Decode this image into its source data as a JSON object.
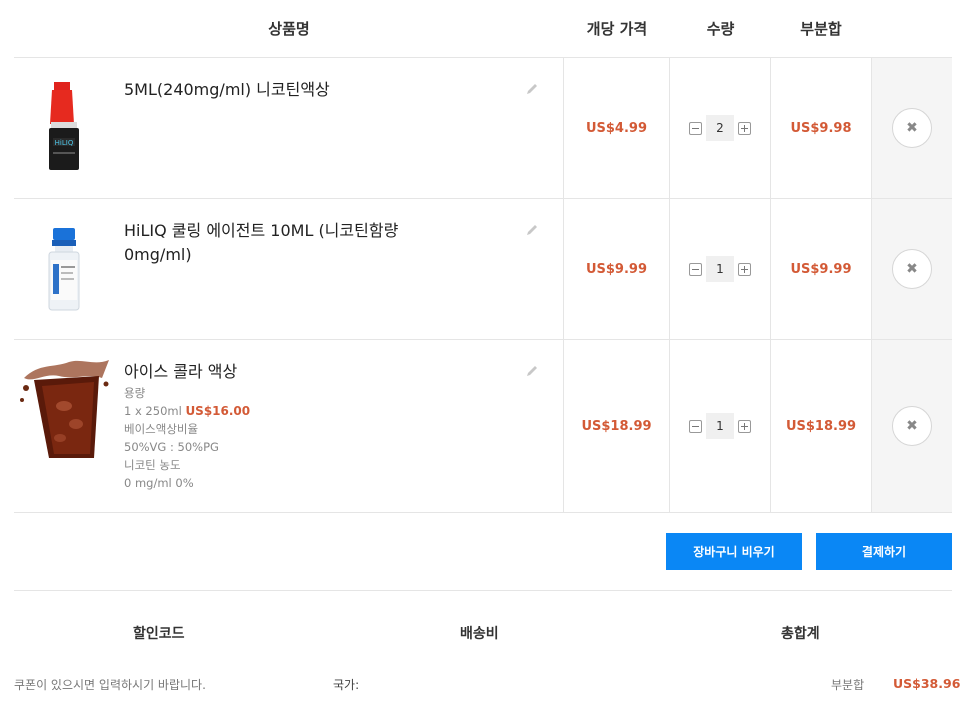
{
  "table": {
    "headers": {
      "product": "상품명",
      "price": "개당 가격",
      "qty": "수량",
      "subtotal": "부분합"
    }
  },
  "items": [
    {
      "name": "5ML(240mg/ml) 니코틴액상",
      "price": "US$4.99",
      "qty": "2",
      "subtotal": "US$9.98",
      "image": "red-cap-bottle"
    },
    {
      "name": "HiLIQ 쿨링 에이전트 10ML (니코틴함량 0mg/ml)",
      "price": "US$9.99",
      "qty": "1",
      "subtotal": "US$9.99",
      "image": "blue-cap-bottle"
    },
    {
      "name": "아이스 콜라 액상",
      "price": "US$18.99",
      "qty": "1",
      "subtotal": "US$18.99",
      "image": "cola-glass",
      "meta": {
        "capacity_label": "용량",
        "capacity_value": "1 x 250ml",
        "capacity_price": "US$16.00",
        "ratio_label": "베이스액상비율",
        "ratio_value": "50%VG : 50%PG",
        "nicotine_label": "니코틴 농도",
        "nicotine_value": "0 mg/ml 0%"
      }
    }
  ],
  "actions": {
    "empty_cart": "장바구니 비우기",
    "checkout": "결제하기"
  },
  "totals": {
    "coupon_heading": "할인코드",
    "shipping_heading": "배송비",
    "total_heading": "총합계",
    "coupon_hint": "쿠폰이 있으시면 입력하시기 바랍니다.",
    "country_label": "국가:",
    "subtotal_label": "부분합",
    "subtotal_value": "US$38.96"
  },
  "colors": {
    "accent": "#0a87f5",
    "price": "#d35a36"
  }
}
